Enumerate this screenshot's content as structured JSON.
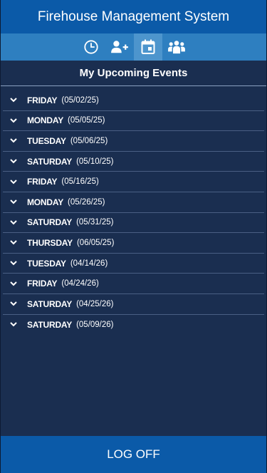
{
  "header": {
    "title": "Firehouse Management System"
  },
  "toolbar": {
    "items": [
      {
        "icon": "clock-icon",
        "active": false
      },
      {
        "icon": "add-user-icon",
        "active": false
      },
      {
        "icon": "calendar-icon",
        "active": true
      },
      {
        "icon": "group-icon",
        "active": false
      }
    ]
  },
  "section": {
    "title": "My Upcoming Events"
  },
  "events": [
    {
      "day": "FRIDAY",
      "date": "(05/02/25)"
    },
    {
      "day": "MONDAY",
      "date": "(05/05/25)"
    },
    {
      "day": "TUESDAY",
      "date": "(05/06/25)"
    },
    {
      "day": "SATURDAY",
      "date": "(05/10/25)"
    },
    {
      "day": "FRIDAY",
      "date": "(05/16/25)"
    },
    {
      "day": "MONDAY",
      "date": "(05/26/25)"
    },
    {
      "day": "SATURDAY",
      "date": "(05/31/25)"
    },
    {
      "day": "THURSDAY",
      "date": "(06/05/25)"
    },
    {
      "day": "TUESDAY",
      "date": "(04/14/26)"
    },
    {
      "day": "FRIDAY",
      "date": "(04/24/26)"
    },
    {
      "day": "SATURDAY",
      "date": "(04/25/26)"
    },
    {
      "day": "SATURDAY",
      "date": "(05/09/26)"
    }
  ],
  "footer": {
    "logoff_label": "LOG OFF"
  },
  "colors": {
    "header_bg": "#0b5aa8",
    "toolbar_bg": "#2e7fc0",
    "toolbar_active_bg": "#4d95cd",
    "body_bg": "#1a2e50",
    "footer_bg": "#0b5aa8"
  }
}
